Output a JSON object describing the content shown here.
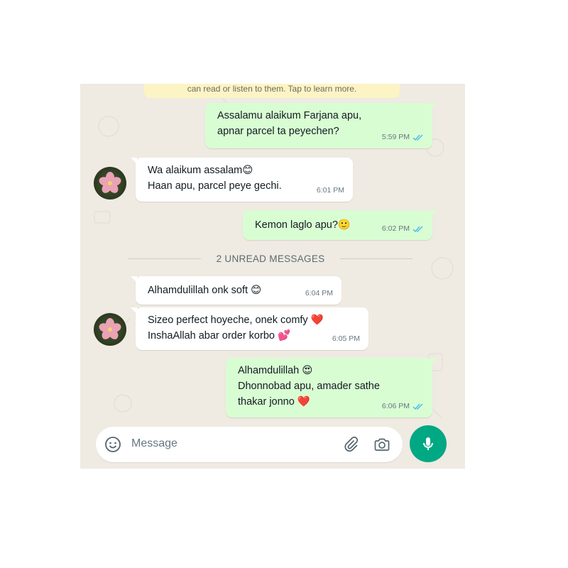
{
  "notice": {
    "text": "can read or listen to them. Tap to learn more."
  },
  "messages": [
    {
      "direction": "out",
      "lines": [
        "Assalamu alaikum Farjana apu,",
        "apnar parcel ta peyechen?"
      ],
      "time": "5:59 PM",
      "read": true
    },
    {
      "direction": "in",
      "lines": [
        "Wa alaikum assalam😊",
        "Haan apu, parcel peye gechi."
      ],
      "time": "6:01 PM"
    },
    {
      "direction": "out",
      "lines": [
        "Kemon laglo apu?🙂"
      ],
      "time": "6:02 PM",
      "read": true
    },
    {
      "direction": "in",
      "lines": [
        "Alhamdulillah onk soft 😊"
      ],
      "time": "6:04 PM"
    },
    {
      "direction": "in",
      "lines": [
        "Sizeo perfect hoyeche, onek comfy ❤️",
        "InshaAllah abar order korbo 💕"
      ],
      "time": "6:05 PM"
    },
    {
      "direction": "out",
      "lines": [
        "Alhamdulillah 😍",
        "Dhonnobad apu, amader sathe",
        "thakar jonno ❤️"
      ],
      "time": "6:06 PM",
      "read": true
    }
  ],
  "unread_divider": {
    "text": "2 UNREAD MESSAGES"
  },
  "composer": {
    "placeholder": "Message"
  },
  "icons": {
    "emoji": "emoji-icon",
    "attach": "paperclip-icon",
    "camera": "camera-icon",
    "mic": "microphone-icon",
    "ticks": "double-check-icon",
    "avatar": "flower-avatar"
  },
  "colors": {
    "chat_bg": "#efeae2",
    "outgoing": "#d9fdd3",
    "incoming": "#ffffff",
    "read_tick": "#53bdeb",
    "mic_button": "#00a884",
    "notice_bg": "#fdf4c5"
  }
}
